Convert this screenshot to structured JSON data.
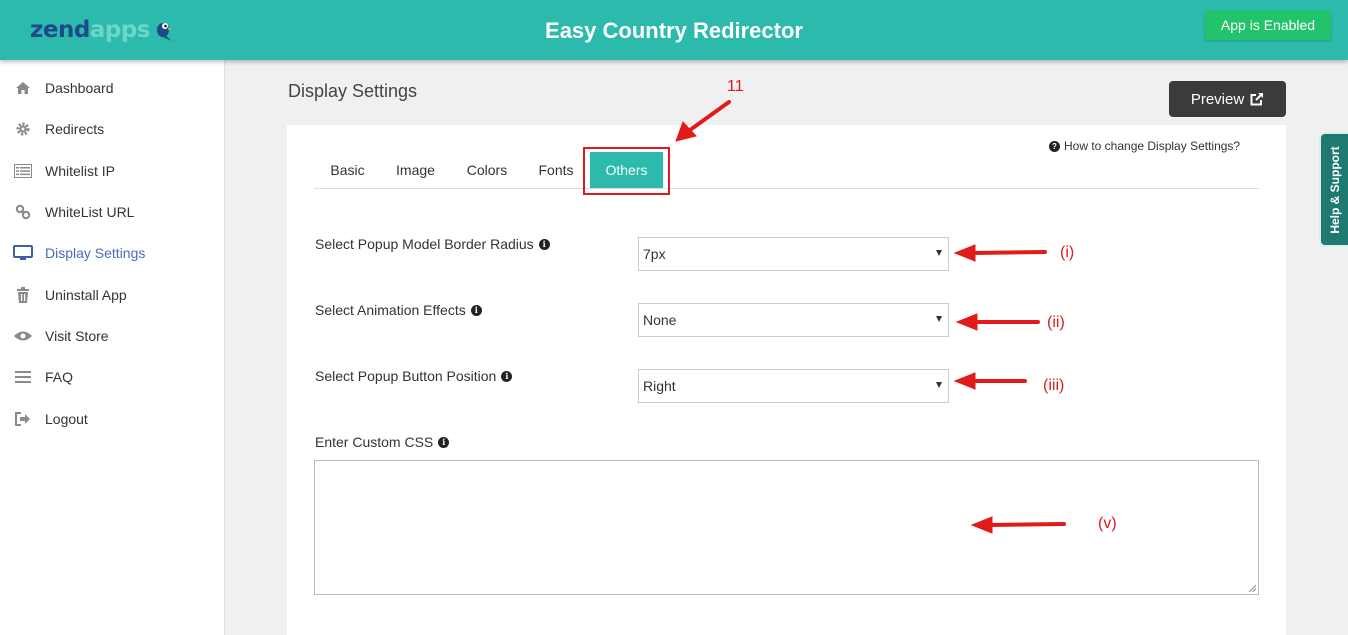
{
  "header": {
    "logo": {
      "part1": "zend",
      "part2": "apps"
    },
    "title": "Easy Country Redirector",
    "status_button": "App is Enabled"
  },
  "sidebar": {
    "items": [
      {
        "label": "Dashboard",
        "icon": "home-icon"
      },
      {
        "label": "Redirects",
        "icon": "gear-icon"
      },
      {
        "label": "Whitelist IP",
        "icon": "list-icon"
      },
      {
        "label": "WhiteList URL",
        "icon": "link-icon"
      },
      {
        "label": "Display Settings",
        "icon": "monitor-icon",
        "active": true
      },
      {
        "label": "Uninstall App",
        "icon": "trash-icon"
      },
      {
        "label": "Visit Store",
        "icon": "eye-icon"
      },
      {
        "label": "FAQ",
        "icon": "bars-icon"
      },
      {
        "label": "Logout",
        "icon": "sign-out-icon"
      }
    ]
  },
  "main": {
    "page_title": "Display Settings",
    "preview_button": "Preview",
    "help_link": "How to change Display Settings?",
    "tabs": [
      {
        "label": "Basic"
      },
      {
        "label": "Image"
      },
      {
        "label": "Colors"
      },
      {
        "label": "Fonts"
      },
      {
        "label": "Others",
        "active": true
      }
    ],
    "fields": {
      "border_radius": {
        "label": "Select Popup Model Border Radius",
        "value": "7px"
      },
      "animation": {
        "label": "Select Animation Effects",
        "value": "None"
      },
      "button_position": {
        "label": "Select Popup Button Position",
        "value": "Right"
      },
      "custom_css": {
        "label": "Enter Custom CSS",
        "value": ""
      }
    }
  },
  "annotations": {
    "step": "11",
    "i": "(i)",
    "ii": "(ii)",
    "iii": "(iii)",
    "v": "(v)",
    "color": "#e01b1b"
  },
  "side_tab": "Help & Support",
  "colors": {
    "header": "#2bbaab",
    "enabled": "#22c36b",
    "active_nav": "#4a6bb8",
    "preview": "#3b3b3b"
  }
}
